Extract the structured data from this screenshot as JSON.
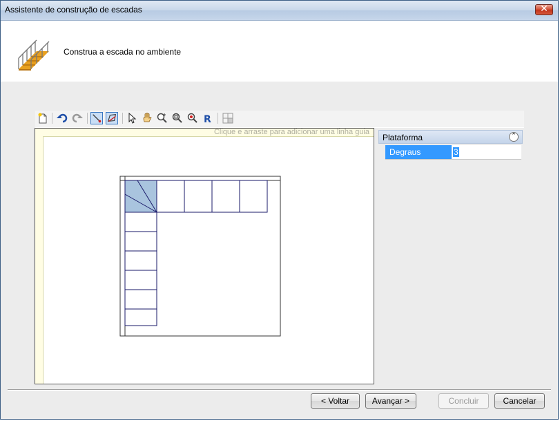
{
  "window": {
    "title": "Assistente de construção de escadas"
  },
  "header": {
    "subtitle": "Construa a escada no ambiente",
    "icon": "stair-icon"
  },
  "toolbar": {
    "items": [
      "new-icon",
      "undo-icon",
      "redo-icon",
      "draw-line-icon",
      "draw-polygon-icon",
      "select-icon",
      "pan-hand-icon",
      "zoom-in-icon",
      "zoom-window-icon",
      "zoom-out-icon",
      "reset-view-icon",
      "grid-properties-icon"
    ]
  },
  "canvas": {
    "guide_hint": "Clique e arraste para adicionar uma linha guia"
  },
  "properties": {
    "section": "Plataforma",
    "rows": [
      {
        "name": "Degraus",
        "value": "3"
      }
    ]
  },
  "buttons": {
    "back": "< Voltar",
    "next": "Avançar >",
    "finish": "Concluir",
    "cancel": "Cancelar"
  },
  "colors": {
    "accent": "#3399ff",
    "landing": "#a9c4de",
    "stair_line": "#1a1a6a"
  }
}
